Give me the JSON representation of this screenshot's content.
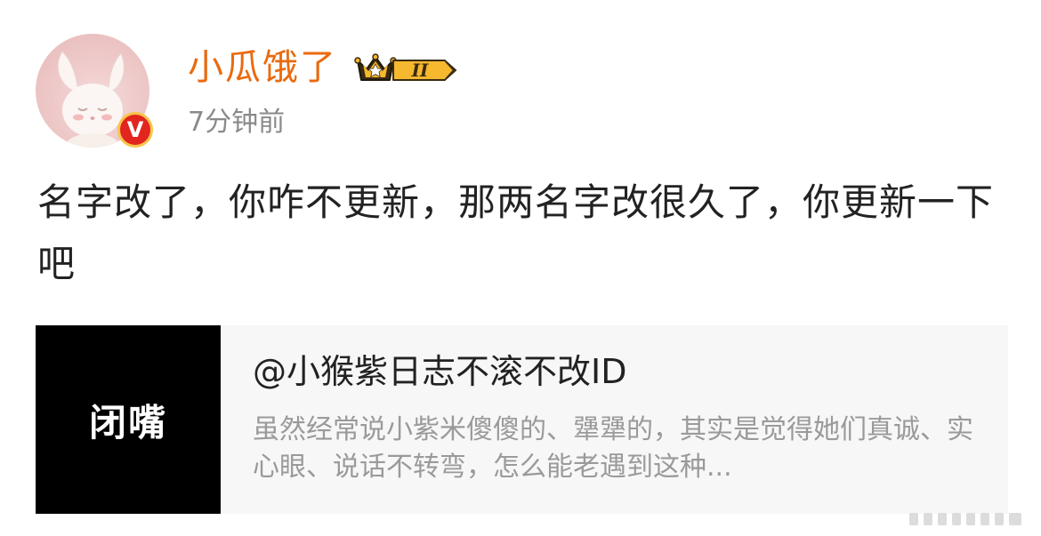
{
  "post": {
    "author": {
      "name": "小瓜饿了",
      "verified_badge_letter": "V",
      "vip_level": "II",
      "avatar_icon": "rabbit-avatar"
    },
    "timestamp": "7分钟前",
    "body_text": "名字改了，你咋不更新，那两名字改很久了，你更新一下吧"
  },
  "link_card": {
    "thumbnail_text": "闭嘴",
    "title": "@小猴紫日志不滚不改ID",
    "description": "虽然经常说小紫米傻傻的、犟犟的，其实是觉得她们真诚、实心眼、说话不转弯，怎么能老遇到这种..."
  },
  "colors": {
    "username": "#ea6a0e",
    "timestamp": "#8a8a8a",
    "verified_badge": "#e2261f",
    "vip_gold": "#f5b82e",
    "card_bg": "#f7f7f7",
    "thumb_bg": "#000000"
  }
}
